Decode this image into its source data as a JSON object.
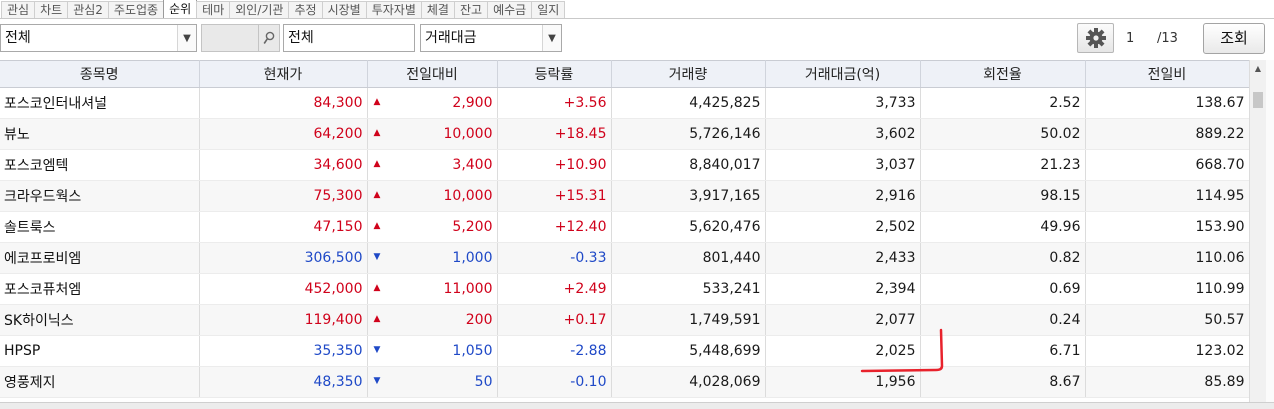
{
  "tabs": [
    "관심",
    "차트",
    "관심2",
    "주도업종",
    "순위",
    "테마",
    "외인/기관",
    "추정",
    "시장별",
    "투자자별",
    "체결",
    "잔고",
    "예수금",
    "일지"
  ],
  "active_tab": "순위",
  "toolbar": {
    "market_filter": "전체",
    "code_input_value": "",
    "category_filter": "전체",
    "ranking_criteria": "거래대금",
    "page_current": "1",
    "page_total": "/13",
    "query_button": "조회"
  },
  "icons": {
    "search": "search-icon",
    "settings": "gear-icon",
    "dropdown": "chevron-down-icon"
  },
  "colors": {
    "up": "#d0021b",
    "down": "#1f49c7",
    "header_bg": "#eef1f7",
    "annotation": "#e8222c"
  },
  "columns": [
    "종목명",
    "현재가",
    "전일대비",
    "등락률",
    "거래량",
    "거래대금(억)",
    "회전율",
    "전일비"
  ],
  "rows": [
    {
      "name": "포스코인터내셔널",
      "price": "84,300",
      "dir": "up",
      "change": "2,900",
      "rate": "+3.56",
      "volume": "4,425,825",
      "amount": "3,733",
      "turnover": "2.52",
      "prev_ratio": "138.67"
    },
    {
      "name": "뷰노",
      "price": "64,200",
      "dir": "up",
      "change": "10,000",
      "rate": "+18.45",
      "volume": "5,726,146",
      "amount": "3,602",
      "turnover": "50.02",
      "prev_ratio": "889.22"
    },
    {
      "name": "포스코엠텍",
      "price": "34,600",
      "dir": "up",
      "change": "3,400",
      "rate": "+10.90",
      "volume": "8,840,017",
      "amount": "3,037",
      "turnover": "21.23",
      "prev_ratio": "668.70"
    },
    {
      "name": "크라우드웍스",
      "price": "75,300",
      "dir": "up",
      "change": "10,000",
      "rate": "+15.31",
      "volume": "3,917,165",
      "amount": "2,916",
      "turnover": "98.15",
      "prev_ratio": "114.95"
    },
    {
      "name": "솔트룩스",
      "price": "47,150",
      "dir": "up",
      "change": "5,200",
      "rate": "+12.40",
      "volume": "5,620,476",
      "amount": "2,502",
      "turnover": "49.96",
      "prev_ratio": "153.90"
    },
    {
      "name": "에코프로비엠",
      "price": "306,500",
      "dir": "down",
      "change": "1,000",
      "rate": "-0.33",
      "volume": "801,440",
      "amount": "2,433",
      "turnover": "0.82",
      "prev_ratio": "110.06"
    },
    {
      "name": "포스코퓨처엠",
      "price": "452,000",
      "dir": "up",
      "change": "11,000",
      "rate": "+2.49",
      "volume": "533,241",
      "amount": "2,394",
      "turnover": "0.69",
      "prev_ratio": "110.99"
    },
    {
      "name": "SK하이닉스",
      "price": "119,400",
      "dir": "up",
      "change": "200",
      "rate": "+0.17",
      "volume": "1,749,591",
      "amount": "2,077",
      "turnover": "0.24",
      "prev_ratio": "50.57"
    },
    {
      "name": "HPSP",
      "price": "35,350",
      "dir": "down",
      "change": "1,050",
      "rate": "-2.88",
      "volume": "5,448,699",
      "amount": "2,025",
      "turnover": "6.71",
      "prev_ratio": "123.02"
    },
    {
      "name": "영풍제지",
      "price": "48,350",
      "dir": "down",
      "change": "50",
      "rate": "-0.10",
      "volume": "4,028,069",
      "amount": "1,956",
      "turnover": "8.67",
      "prev_ratio": "85.89"
    }
  ]
}
